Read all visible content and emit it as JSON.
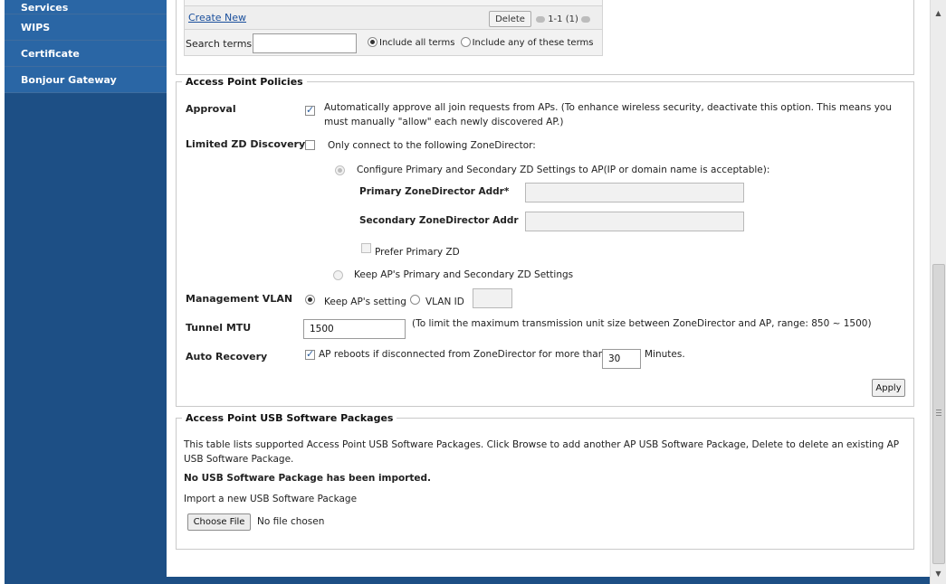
{
  "sidebar": {
    "items": [
      {
        "label": "Services"
      },
      {
        "label": "WIPS"
      },
      {
        "label": "Certificate"
      },
      {
        "label": "Bonjour Gateway"
      }
    ]
  },
  "list_panel": {
    "create_new": "Create New",
    "delete_label": "Delete",
    "pager_text": "1-1 (1)",
    "search_label": "Search terms",
    "search_value": "",
    "include_all": "Include all terms",
    "include_any": "Include any of these terms"
  },
  "ap_policies": {
    "title": "Access Point Policies",
    "approval": {
      "label": "Approval",
      "checked": true,
      "text": "Automatically approve all join requests from APs. (To enhance wireless security, deactivate this option. This means you must manually \"allow\" each newly discovered AP.)"
    },
    "limited_zd": {
      "label": "Limited ZD Discovery",
      "checked": false,
      "text": "Only connect to the following ZoneDirector:",
      "configure_option": "Configure Primary and Secondary ZD Settings to AP(IP or domain name is acceptable):",
      "primary_label": "Primary ZoneDirector Addr*",
      "primary_value": "",
      "secondary_label": "Secondary ZoneDirector Addr",
      "secondary_value": "",
      "prefer_primary": "Prefer Primary ZD",
      "keep_option": "Keep AP's Primary and Secondary ZD Settings"
    },
    "mgmt_vlan": {
      "label": "Management VLAN",
      "keep_setting": "Keep AP's setting",
      "vlan_id": "VLAN ID",
      "vlan_value": ""
    },
    "tunnel_mtu": {
      "label": "Tunnel MTU",
      "value": "1500",
      "hint": "(To limit the maximum transmission unit size between ZoneDirector and AP, range: 850 ~ 1500)"
    },
    "auto_recovery": {
      "label": "Auto Recovery",
      "checked": true,
      "text_before": "AP reboots if disconnected from ZoneDirector for more than",
      "minutes_value": "30",
      "text_after": "Minutes."
    },
    "apply_label": "Apply"
  },
  "usb_packages": {
    "title": "Access Point USB Software Packages",
    "description": "This table lists supported Access Point USB Software Packages. Click Browse to add another AP USB Software Package, Delete to delete an existing AP USB Software Package.",
    "none_imported": "No USB Software Package has been imported.",
    "import_label": "Import a new USB Software Package",
    "choose_file": "Choose File",
    "no_file": "No file chosen"
  },
  "colors": {
    "sidebar_bg": "#1d4f85",
    "sidebar_item": "#1f5a98",
    "link": "#1a4f9c"
  },
  "icons": [
    "scroll-up-arrow-icon",
    "scroll-down-arrow-icon",
    "pager-prev-icon",
    "pager-next-icon"
  ]
}
